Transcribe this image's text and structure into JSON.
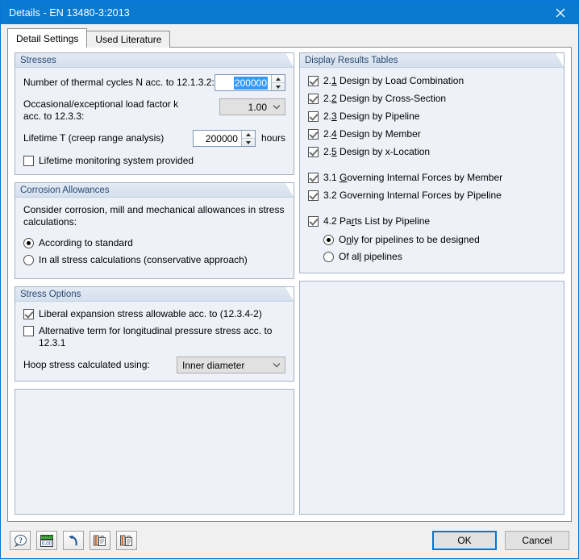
{
  "window": {
    "title": "Details - EN 13480-3:2013",
    "close_icon": "close-icon"
  },
  "tabs": [
    {
      "label": "Detail Settings",
      "active": true
    },
    {
      "label": "Used Literature",
      "active": false
    }
  ],
  "left": {
    "stresses": {
      "title": "Stresses",
      "thermal_cycles_label": "Number of thermal cycles N acc. to 12.1.3.2:",
      "thermal_cycles_value": "200000",
      "load_factor_label_line1": "Occasional/exceptional load factor k",
      "load_factor_label_line2": "acc. to 12.3.3:",
      "load_factor_value": "1.00",
      "lifetime_label": "Lifetime T (creep range analysis)",
      "lifetime_value": "200000",
      "lifetime_unit": "hours",
      "monitoring_label": "Lifetime monitoring system provided",
      "monitoring_checked": false
    },
    "corrosion": {
      "title": "Corrosion Allowances",
      "description_line1": "Consider corrosion, mill and mechanical allowances in stress",
      "description_line2": "calculations:",
      "option1": "According to standard",
      "option1_selected": true,
      "option2": "In all stress calculations (conservative approach)",
      "option2_selected": false
    },
    "stress_options": {
      "title": "Stress Options",
      "liberal_label": "Liberal expansion stress allowable acc. to (12.3.4-2)",
      "liberal_checked": true,
      "alternative_label": "Alternative term for longitudinal pressure stress acc. to 12.3.1",
      "alternative_checked": false,
      "hoop_label": "Hoop stress calculated using:",
      "hoop_value": "Inner diameter"
    }
  },
  "right": {
    "results": {
      "title": "Display Results Tables",
      "items": [
        {
          "num": "2.",
          "mnem": "1",
          "rest": " Design by Load Combination",
          "checked": true
        },
        {
          "num": "2.",
          "mnem": "2",
          "rest": " Design by Cross-Section",
          "checked": true
        },
        {
          "num": "2.",
          "mnem": "3",
          "rest": " Design by Pipeline",
          "checked": true
        },
        {
          "num": "2.",
          "mnem": "4",
          "rest": " Design by Member",
          "checked": true
        },
        {
          "num": "2.",
          "mnem": "5",
          "rest": " Design by x-Location",
          "checked": true
        }
      ],
      "items2": [
        {
          "num": "3.1 ",
          "mnem": "G",
          "rest": "overning Internal Forces by Member",
          "checked": true
        },
        {
          "num": "3.2 Governing Internal Forces by Pipeline",
          "mnem": "",
          "rest": "",
          "checked": true
        }
      ],
      "parts_list": {
        "pre": "4.2 Pa",
        "mnem": "r",
        "rest": "ts List by Pipeline",
        "checked": true
      },
      "radio1": {
        "pre": "O",
        "mnem": "n",
        "rest": "ly for pipelines to be designed",
        "selected": true
      },
      "radio2": {
        "pre": "Of al",
        "mnem": "l",
        "rest": " pipelines",
        "selected": false
      }
    }
  },
  "bottom": {
    "tools": [
      {
        "name": "help-icon",
        "title": "help"
      },
      {
        "name": "units-icon",
        "title": "units"
      },
      {
        "name": "reset-icon",
        "title": "reset"
      },
      {
        "name": "copy-icon",
        "title": "copy"
      },
      {
        "name": "paste-icon",
        "title": "paste"
      }
    ],
    "ok_label": "OK",
    "cancel_label": "Cancel"
  },
  "colors": {
    "title_bar": "#0a7ad1",
    "accent": "#0078d7",
    "group_bg": "#eef1f7",
    "selection": "#3399ff"
  }
}
